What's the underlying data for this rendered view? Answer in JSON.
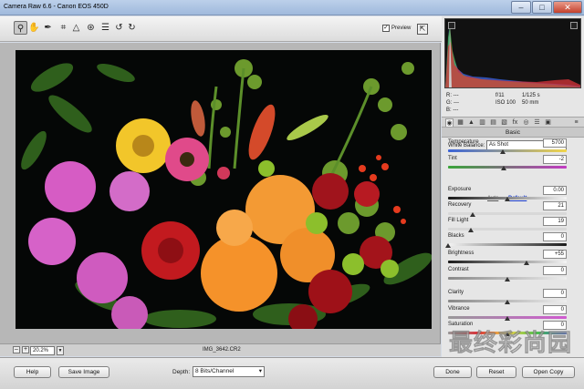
{
  "window": {
    "title": "Camera Raw 6.6  -  Canon EOS 450D"
  },
  "toolbar": {
    "tools": [
      "zoom-icon",
      "hand-icon",
      "white-balance-icon",
      "crop-icon",
      "straighten-icon",
      "red-eye-icon",
      "preferences-icon",
      "rotate-left-icon",
      "rotate-right-icon"
    ],
    "preview_label": "Preview",
    "preview_checked": true
  },
  "viewer": {
    "zoom": "20.2%",
    "filename": "IMG_3642.CR2"
  },
  "info": {
    "r": "R:",
    "g": "G:",
    "b": "B:",
    "dashes": "---",
    "aperture": "f/11",
    "shutter": "1/125 s",
    "iso": "ISO 100",
    "focal": "50 mm"
  },
  "panel": {
    "section_title": "Basic",
    "white_balance_label": "White Balance:",
    "white_balance_value": "As Shot",
    "auto_label": "Auto",
    "default_label": "Default",
    "sliders": [
      {
        "label": "Temperature",
        "value": "5700",
        "pos": 0.46
      },
      {
        "label": "Tint",
        "value": "-2",
        "pos": 0.47
      },
      {
        "label": "Exposure",
        "value": "0.00",
        "pos": 0.5
      },
      {
        "label": "Recovery",
        "value": "21",
        "pos": 0.21
      },
      {
        "label": "Fill Light",
        "value": "19",
        "pos": 0.19
      },
      {
        "label": "Blacks",
        "value": "0",
        "pos": 0.0
      },
      {
        "label": "Brightness",
        "value": "+55",
        "pos": 0.66
      },
      {
        "label": "Contrast",
        "value": "0",
        "pos": 0.5
      },
      {
        "label": "Clarity",
        "value": "0",
        "pos": 0.5
      },
      {
        "label": "Vibrance",
        "value": "0",
        "pos": 0.5
      },
      {
        "label": "Saturation",
        "value": "0",
        "pos": 0.5
      }
    ]
  },
  "bottom": {
    "help": "Help",
    "save": "Save Image",
    "depth_label": "Depth:",
    "depth_value": "8 Bits/Channel",
    "done": "Done",
    "reset": "Reset",
    "open": "Open Copy"
  },
  "colors": {
    "temperature_track": [
      "#3a63d8",
      "#f2d64a"
    ],
    "tint_track": [
      "#3aa53a",
      "#c23ac2"
    ],
    "accent_link": "#1a3ccc"
  },
  "watermark_text": "最终彩尚园"
}
